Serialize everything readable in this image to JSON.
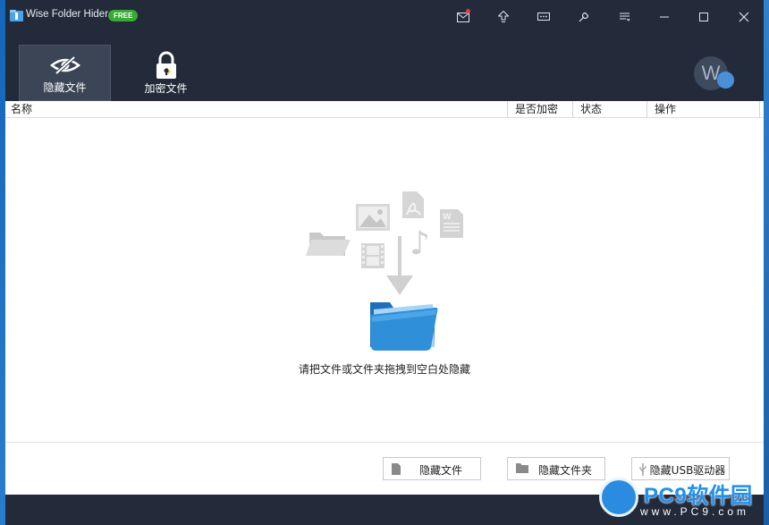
{
  "app": {
    "title": "Wise Folder Hider",
    "badge": "FREE"
  },
  "titlebar_buttons": [
    {
      "name": "mail-icon",
      "has_notification": true
    },
    {
      "name": "upgrade-icon"
    },
    {
      "name": "message-icon"
    },
    {
      "name": "settings-wrench-icon"
    },
    {
      "name": "menu-icon"
    },
    {
      "name": "minimize-icon"
    },
    {
      "name": "maximize-icon"
    },
    {
      "name": "close-icon"
    }
  ],
  "tabs": [
    {
      "label": "隐藏文件",
      "icon": "hidden-eye-icon",
      "active": true
    },
    {
      "label": "加密文件",
      "icon": "padlock-icon",
      "active": false
    }
  ],
  "account": {
    "avatar_letter": "W"
  },
  "columns": [
    "名称",
    "是否加密",
    "状态",
    "操作"
  ],
  "empty_state": {
    "hint": "请把文件或文件夹拖拽到空白处隐藏",
    "icons": [
      "folder-icon",
      "image-icon",
      "pdf-icon",
      "word-doc-icon",
      "film-icon",
      "music-note-icon",
      "down-arrow-icon",
      "blue-folder-icon"
    ]
  },
  "actions": {
    "hide_file": "隐藏文件",
    "hide_folder": "隐藏文件夹",
    "hide_usb": "隐藏USB驱动器"
  },
  "watermark": {
    "brand": "PC9软件园",
    "url": "www.PC9.com"
  },
  "colors": {
    "titlebar": "#232b3b",
    "active_tab": "#3c4556",
    "free_badge": "#3aa935",
    "folder_blue": "#2f8fd8"
  }
}
